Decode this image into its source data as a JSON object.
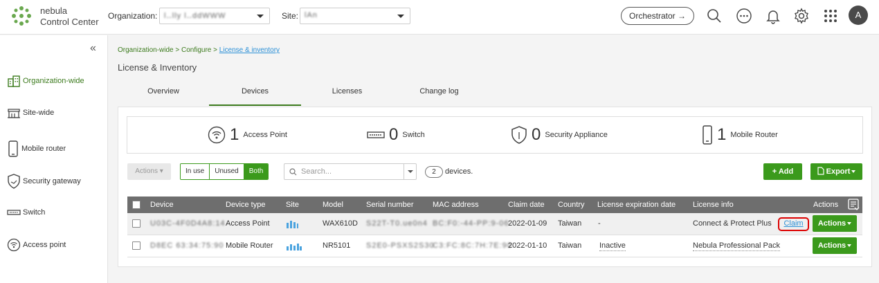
{
  "header": {
    "brand_line1": "nebula",
    "brand_line2": "Control Center",
    "org_label": "Organization:",
    "org_value": "l‥lly l‥ddWWW",
    "site_label": "Site:",
    "site_value": "lAn",
    "orchestrator_label": "Orchestrator →",
    "avatar_letter": "A"
  },
  "sidebar": {
    "collapse_glyph": "«",
    "items": [
      {
        "label": "Organization-wide",
        "icon": "building-icon",
        "active": true
      },
      {
        "label": "Site-wide",
        "icon": "storefront-icon",
        "active": false
      },
      {
        "label": "Mobile router",
        "icon": "phone-icon",
        "active": false
      },
      {
        "label": "Security gateway",
        "icon": "shield-icon",
        "active": false
      },
      {
        "label": "Switch",
        "icon": "switch-icon",
        "active": false
      },
      {
        "label": "Access point",
        "icon": "wifi-icon",
        "active": false
      }
    ]
  },
  "breadcrumb": {
    "part1": "Organization-wide > Configure > ",
    "current": "License & inventory"
  },
  "page_title": "License & Inventory",
  "tabs": [
    {
      "label": "Overview"
    },
    {
      "label": "Devices"
    },
    {
      "label": "Licenses"
    },
    {
      "label": "Change log"
    }
  ],
  "summary": [
    {
      "count": "1",
      "name": "Access Point"
    },
    {
      "count": "0",
      "name": "Switch"
    },
    {
      "count": "0",
      "name": "Security Appliance"
    },
    {
      "count": "1",
      "name": "Mobile Router"
    }
  ],
  "toolbar": {
    "actions_label": "Actions ▾",
    "filter_in_use": "In use",
    "filter_unused": "Unused",
    "filter_both": "Both",
    "search_placeholder": "Search...",
    "device_count": "2",
    "device_count_label": "devices.",
    "add_label": "+ Add",
    "export_label": "Export"
  },
  "table": {
    "columns": [
      "Device",
      "Device type",
      "Site",
      "Model",
      "Serial number",
      "MAC address",
      "Claim date",
      "Country",
      "License expiration date",
      "License info",
      "Actions"
    ],
    "rows": [
      {
        "device": "U03C-4F0D4A8:14",
        "type": "Access Point",
        "model": "WAX610D",
        "serial": "S22T-T0.ue0n4",
        "mac": "BC:F0:-44-PP:9-06",
        "claim_date": "2022-01-09",
        "country": "Taiwan",
        "expiration": "-",
        "license_info": "Connect & Protect Plus",
        "claim_link": "Claim",
        "action": "Actions"
      },
      {
        "device": "D8EC 63:34:75:90",
        "type": "Mobile Router",
        "model": "NR5101",
        "serial": "S2E0-PSXS2S30",
        "mac": "C3:FC:8C:7H:7E:90",
        "claim_date": "2022-01-10",
        "country": "Taiwan",
        "expiration": "Inactive",
        "license_info": "Nebula Professional Pack",
        "action": "Actions"
      }
    ]
  },
  "colors": {
    "brand_green": "#3b9a1c",
    "link_blue": "#2a8fd6",
    "highlight_red": "#dd0000"
  }
}
